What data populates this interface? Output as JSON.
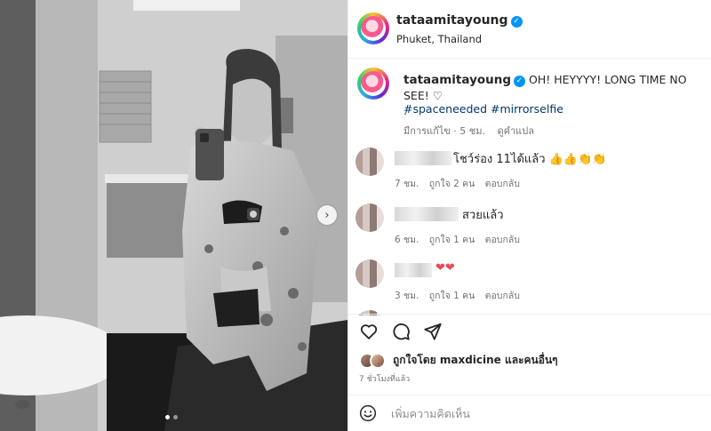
{
  "post": {
    "username": "tataamitayoung",
    "verified": true,
    "location": "Phuket, Thailand",
    "caption": {
      "username": "tataamitayoung",
      "text": "OH! HEYYYY! LONG TIME NO SEE! ♡",
      "line2": ".",
      "hashtags": "#spaceneeded #mirrorselfie",
      "edited": "มีการแก้ไข · 5 ชม.",
      "translate": "ดูคำแปล"
    },
    "carousel": {
      "current": 1,
      "total": 2
    }
  },
  "comments": [
    {
      "text": "โชว์ร่อง 11ได้แล้ว 👍👍👏👏",
      "time": "7 ชม.",
      "likes": "ถูกใจ 2 คน",
      "reply": "ตอบกลับ"
    },
    {
      "text": "สวยแล้ว",
      "time": "6 ชม.",
      "likes": "ถูกใจ 1 คน",
      "reply": "ตอบกลับ"
    },
    {
      "text": "❤❤",
      "time": "3 ชม.",
      "likes": "ถูกใจ 1 คน",
      "reply": "ตอบกลับ"
    }
  ],
  "actions": {
    "icons": [
      "heart-icon",
      "comment-icon",
      "share-icon"
    ]
  },
  "likes_summary": "ถูกใจโดย maxdicine และคนอื่นๆ",
  "time_ago": "7 ชั่วโมงที่แล้ว",
  "add_comment": {
    "placeholder": "เพิ่มความคิดเห็น"
  },
  "colors": {
    "link": "#00376b",
    "verified": "#0095f6",
    "heart": "#ed4956",
    "meta": "#737373"
  }
}
